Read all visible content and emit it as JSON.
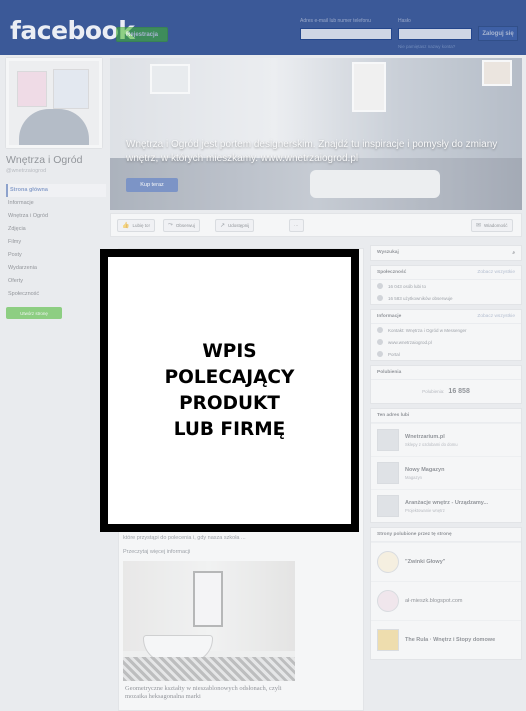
{
  "topbar": {
    "logo": "facebook",
    "register": "Rejestracja",
    "email_label": "Adres e-mail lub numer telefonu",
    "password_label": "Hasło",
    "forgot": "Nie pamiętasz nazwy konta?",
    "login": "Zaloguj się"
  },
  "sidebar": {
    "page_name": "Wnętrza i Ogród",
    "handle": "@wnetrzaiogrod",
    "nav": [
      {
        "label": "Strona główna",
        "active": true
      },
      {
        "label": "Informacje"
      },
      {
        "label": "Wnętrza i Ogród"
      },
      {
        "label": "Zdjęcia"
      },
      {
        "label": "Filmy"
      },
      {
        "label": "Posty"
      },
      {
        "label": "Wydarzenia"
      },
      {
        "label": "Oferty"
      },
      {
        "label": "Społeczność"
      }
    ],
    "create_page": "Utwórz stronę"
  },
  "cover": {
    "text": "Wnętrza i Ogród jest portem designerskim. Znajdź tu inspiracje i pomysły do zmiany wnętrz, w których mieszkamy. www.wnetrzaiogrod.pl",
    "button": "Kup teraz"
  },
  "actionbar": {
    "like": "Lubię to!",
    "follow": "Obserwuj",
    "share": "Udostępnij",
    "more": "···",
    "message": "Wiadomość"
  },
  "rightcol": {
    "search_label": "Wyszukaj",
    "community_hdr": "Społeczność",
    "community_link": "Zobacz wszystkie",
    "community_rows": [
      "16 043 osób lubi to",
      "16 583 użytkowników obserwuje"
    ],
    "info_hdr": "Informacje",
    "info_link": "Zobacz wszystkie",
    "info_rows": [
      "Kontakt: Wnętrza i Ogród w Messenger",
      "www.wnetrzaiogrod.pl",
      "Portal"
    ],
    "likes_hdr": "Polubienia",
    "likes_label": "Polubienia:",
    "likes_count": "16 858",
    "liked_hdr": "Ten adres lubi",
    "liked": [
      {
        "name": "Wnetrzarium.pl",
        "sub": "Sklepy z ozdobami do domu"
      },
      {
        "name": "Nowy Magazyn",
        "sub": "Magazyn"
      },
      {
        "name": "Aranżacje wnętrz - Urządzamy...",
        "sub": "Projektowanie wnętrz"
      }
    ],
    "pages_hdr": "Strony polubione przez tę stronę",
    "pages": [
      {
        "name": "\"Zwinki Głowy\""
      },
      {
        "name": "ał·mieszk.blogspot.com"
      },
      {
        "name": "The Rula · Wnętrz i Stopy domowe"
      }
    ]
  },
  "feed": {
    "text1": "które przystąpi do polecenia i, gdy nasza szkoła ...",
    "text2": "Przeczytaj więcej informacji",
    "caption": "Geometryczne kształty w nieszablonowych odsłonach, czyli mozaika heksagonalna marki"
  },
  "overlay": {
    "line1": "WPIS",
    "line2": "POLECAJĄCY",
    "line3": "PRODUKT",
    "line4": "LUB FIRMĘ"
  }
}
